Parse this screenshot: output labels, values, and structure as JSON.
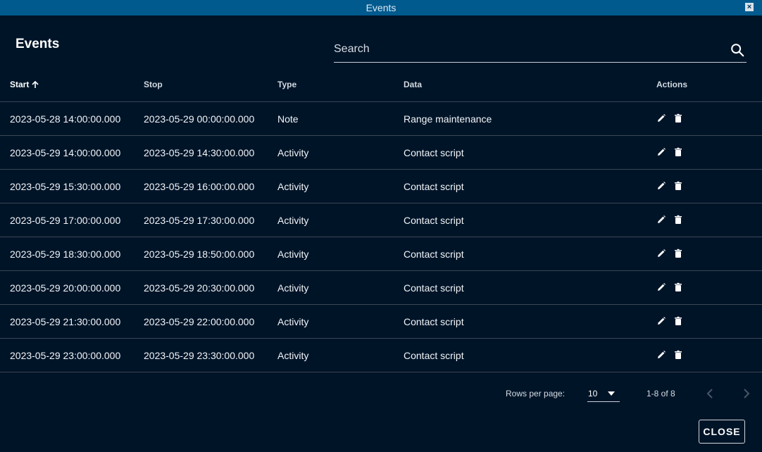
{
  "window": {
    "title": "Events",
    "close_glyph": "×"
  },
  "heading": "Events",
  "search": {
    "placeholder": "Search",
    "value": "",
    "icon": "search-icon"
  },
  "table": {
    "columns": [
      "Start",
      "Stop",
      "Type",
      "Data",
      "Actions"
    ],
    "sort": {
      "column": "Start",
      "direction": "ascending"
    },
    "rows": [
      {
        "start": "2023-05-28 14:00:00.000",
        "stop": "2023-05-29 00:00:00.000",
        "type": "Note",
        "data": "Range maintenance"
      },
      {
        "start": "2023-05-29 14:00:00.000",
        "stop": "2023-05-29 14:30:00.000",
        "type": "Activity",
        "data": "Contact script"
      },
      {
        "start": "2023-05-29 15:30:00.000",
        "stop": "2023-05-29 16:00:00.000",
        "type": "Activity",
        "data": "Contact script"
      },
      {
        "start": "2023-05-29 17:00:00.000",
        "stop": "2023-05-29 17:30:00.000",
        "type": "Activity",
        "data": "Contact script"
      },
      {
        "start": "2023-05-29 18:30:00.000",
        "stop": "2023-05-29 18:50:00.000",
        "type": "Activity",
        "data": "Contact script"
      },
      {
        "start": "2023-05-29 20:00:00.000",
        "stop": "2023-05-29 20:30:00.000",
        "type": "Activity",
        "data": "Contact script"
      },
      {
        "start": "2023-05-29 21:30:00.000",
        "stop": "2023-05-29 22:00:00.000",
        "type": "Activity",
        "data": "Contact script"
      },
      {
        "start": "2023-05-29 23:00:00.000",
        "stop": "2023-05-29 23:30:00.000",
        "type": "Activity",
        "data": "Contact script"
      }
    ],
    "row_actions": [
      "edit-icon",
      "delete-icon"
    ]
  },
  "pagination": {
    "rows_per_page_label": "Rows per page:",
    "rows_per_page_value": "10",
    "range_label": "1-8 of 8",
    "prev_icon": "chevron-left-icon",
    "next_icon": "chevron-right-icon"
  },
  "close_button": "CLOSE",
  "colors": {
    "background": "#001428",
    "titlebar": "#005a8e",
    "divider": "#3a4654",
    "text": "#ffffff"
  }
}
